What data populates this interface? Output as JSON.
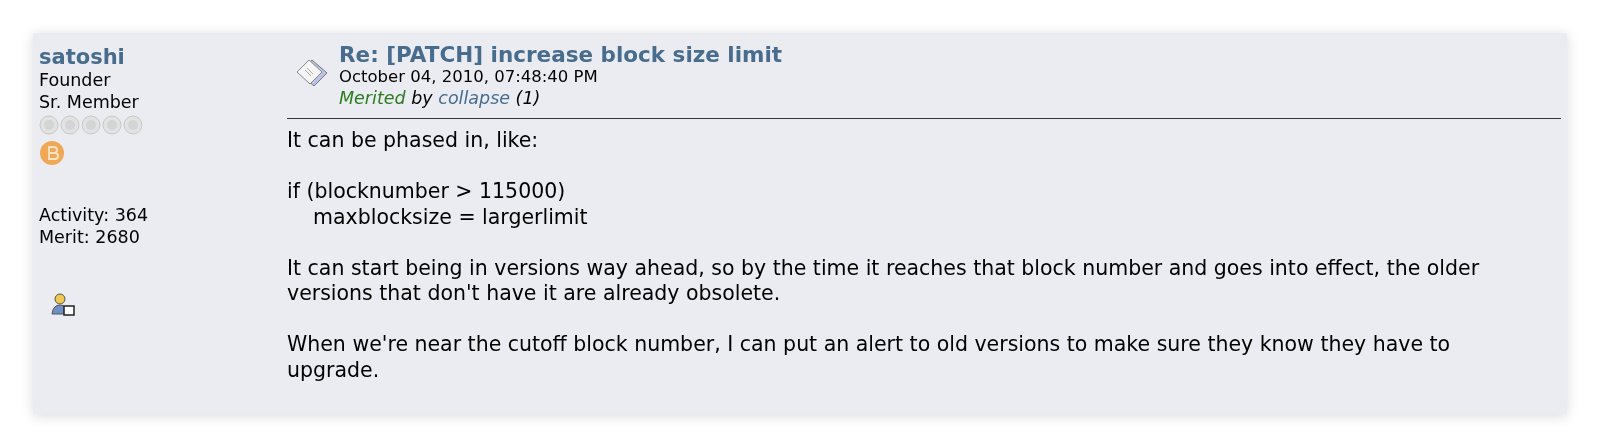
{
  "author": {
    "name": "satoshi",
    "position": "Founder",
    "rank": "Sr. Member",
    "activity": "Activity: 364",
    "merit": "Merit: 2680"
  },
  "post": {
    "title": "Re: [PATCH] increase block size limit",
    "date": "October 04, 2010, 07:48:40 PM",
    "merited": {
      "label": "Merited",
      "by": "by",
      "user": "collapse",
      "count": "(1)"
    },
    "body": [
      {
        "lines": [
          "It can be phased in, like:"
        ]
      },
      {
        "lines": [
          "if (blocknumber > 115000)",
          "    maxblocksize = largerlimit"
        ]
      },
      {
        "lines": [
          "It can start being in versions way ahead, so by the time it reaches that block number and goes into effect, the older",
          "versions that don't have it are already obsolete."
        ]
      },
      {
        "lines": [
          "When we're near the cutoff block number, I can put an alert to old versions to make sure they know they have to",
          "upgrade."
        ]
      }
    ]
  }
}
